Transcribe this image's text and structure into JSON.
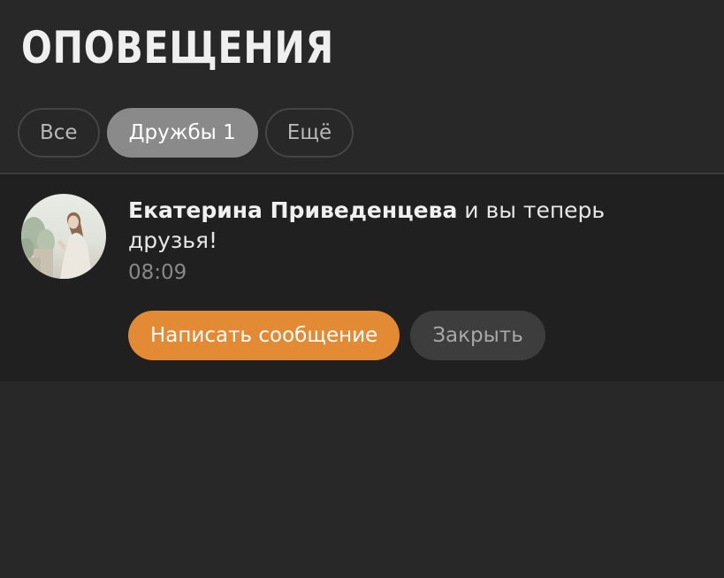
{
  "header": {
    "title": "Оповещения"
  },
  "tabs": [
    {
      "label": "Все",
      "active": false
    },
    {
      "label": "Дружбы 1",
      "active": true
    },
    {
      "label": "Ещё",
      "active": false
    }
  ],
  "notification": {
    "user_name": "Екатерина Приведенцева",
    "message": " и вы теперь друзья!",
    "time": "08:09",
    "avatar_icon": "user-avatar-photo",
    "actions": {
      "write_message": "Написать сообщение",
      "close": "Закрыть"
    }
  },
  "colors": {
    "background": "#282828",
    "card_background": "#202020",
    "accent": "#e38a35",
    "active_tab": "#8a8a8a",
    "secondary_button": "#3d3d3d"
  }
}
